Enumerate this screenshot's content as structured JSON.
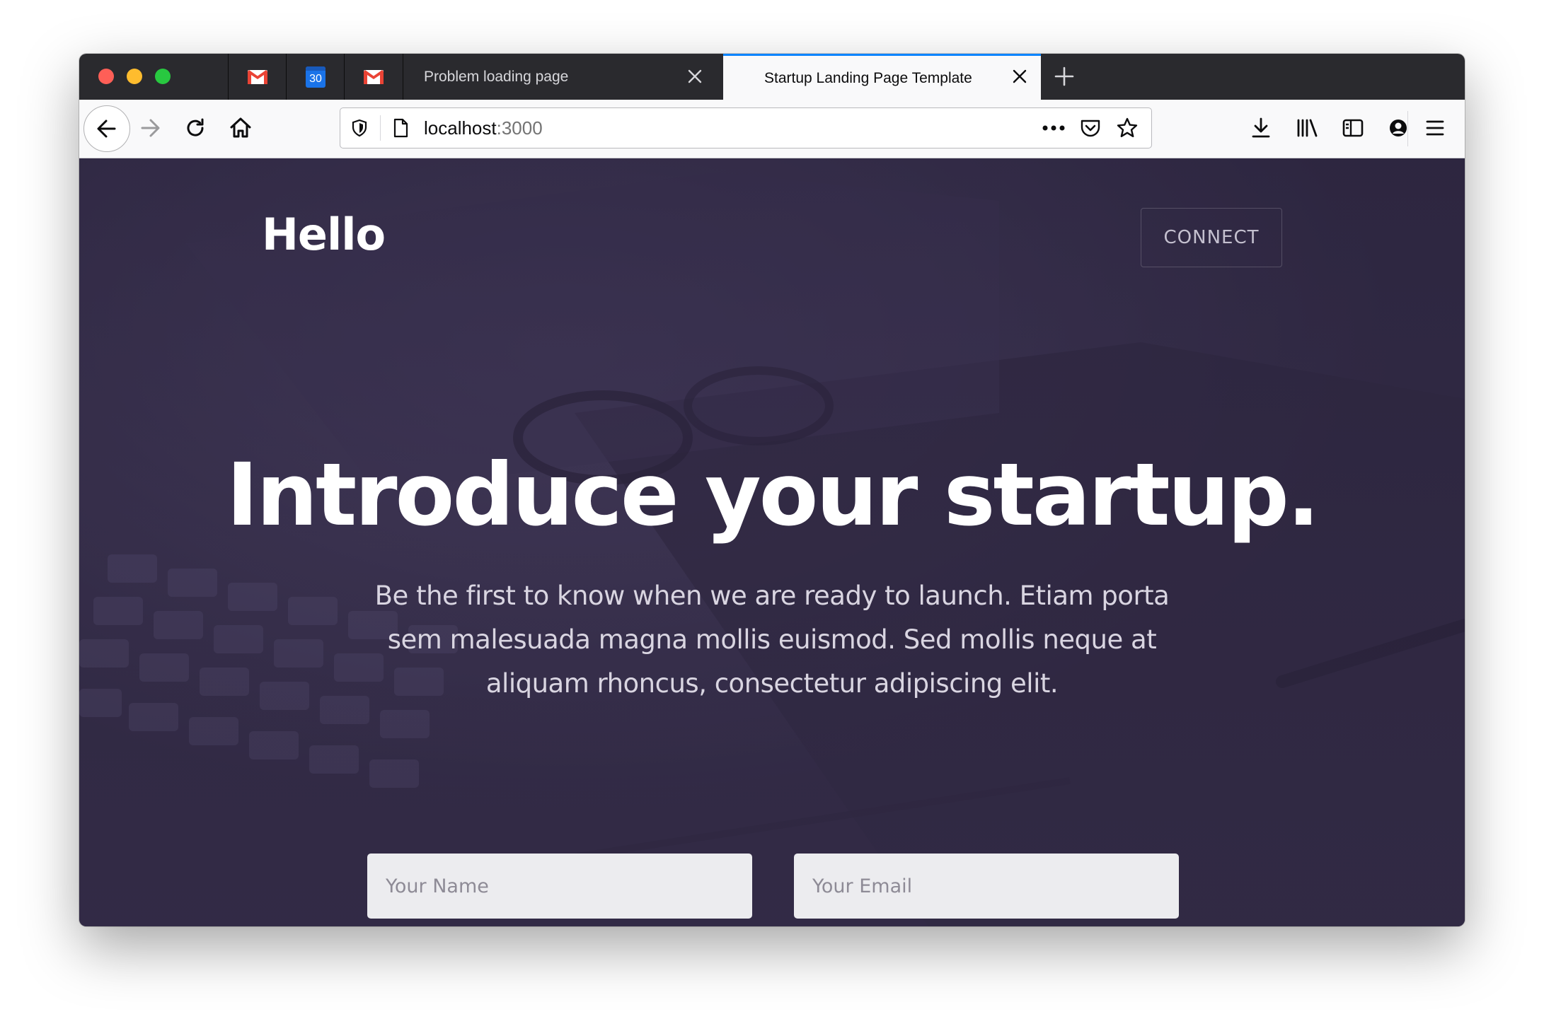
{
  "browser": {
    "pinned_tabs": [
      {
        "name": "gmail",
        "icon": "gmail-icon"
      },
      {
        "name": "calendar",
        "icon": "calendar-icon",
        "day": "30"
      },
      {
        "name": "gmail",
        "icon": "gmail-icon"
      }
    ],
    "tabs": [
      {
        "title": "Problem loading page",
        "active": false
      },
      {
        "title": "Startup Landing Page Template",
        "active": true
      }
    ],
    "url": {
      "host": "localhost",
      "port": ":3000"
    },
    "accent_color": "#0a84ff"
  },
  "page": {
    "brand": "Hello",
    "connect_label": "CONNECT",
    "headline": "Introduce your startup.",
    "subtext": "Be the first to know when we are ready to launch. Etiam porta sem malesuada magna mollis euismod. Sed mollis neque at aliquam rhoncus, consectetur adipiscing elit.",
    "name_placeholder": "Your Name",
    "email_placeholder": "Your Email",
    "submit_color": "#6fc2bd",
    "background_color": "#3a324d"
  }
}
